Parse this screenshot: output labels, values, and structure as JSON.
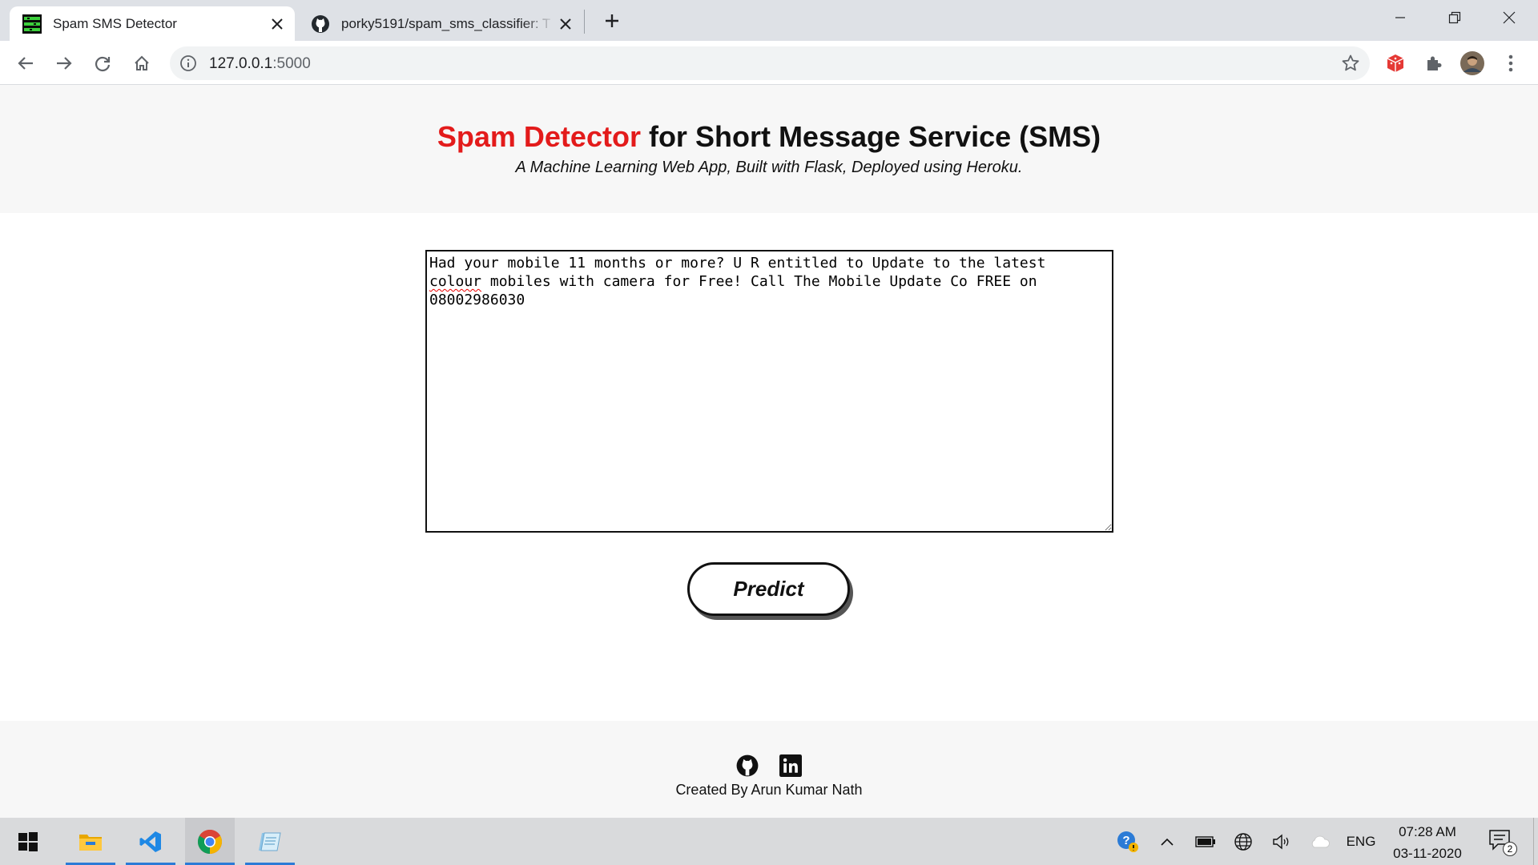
{
  "browser": {
    "tabs": [
      {
        "title": "Spam SMS Detector",
        "active": true,
        "icon": "spam-favicon"
      },
      {
        "title": "porky5191/spam_sms_classifier: T",
        "active": false,
        "icon": "github-icon"
      }
    ],
    "url_host": "127.0.0.1",
    "url_port": ":5000"
  },
  "page": {
    "title_highlight": "Spam Detector",
    "title_rest": " for Short Message Service (SMS)",
    "subtitle": "A Machine Learning Web App, Built with Flask, Deployed using Heroku.",
    "message_before": "Had your mobile 11 months or more? U R entitled to Update to the latest\n",
    "message_flagged_word": "colour",
    "message_after": " mobiles with camera for Free! Call The Mobile Update Co FREE on\n08002986030",
    "predict_label": "Predict",
    "footer_credit": "Created By Arun Kumar Nath"
  },
  "taskbar": {
    "language": "ENG",
    "time": "07:28 AM",
    "date": "03-11-2020",
    "notification_count": "2"
  },
  "colors": {
    "title_accent": "#e31b1b",
    "hero_bg": "#f7f7f7",
    "taskbar_bg": "#d9dadc"
  }
}
